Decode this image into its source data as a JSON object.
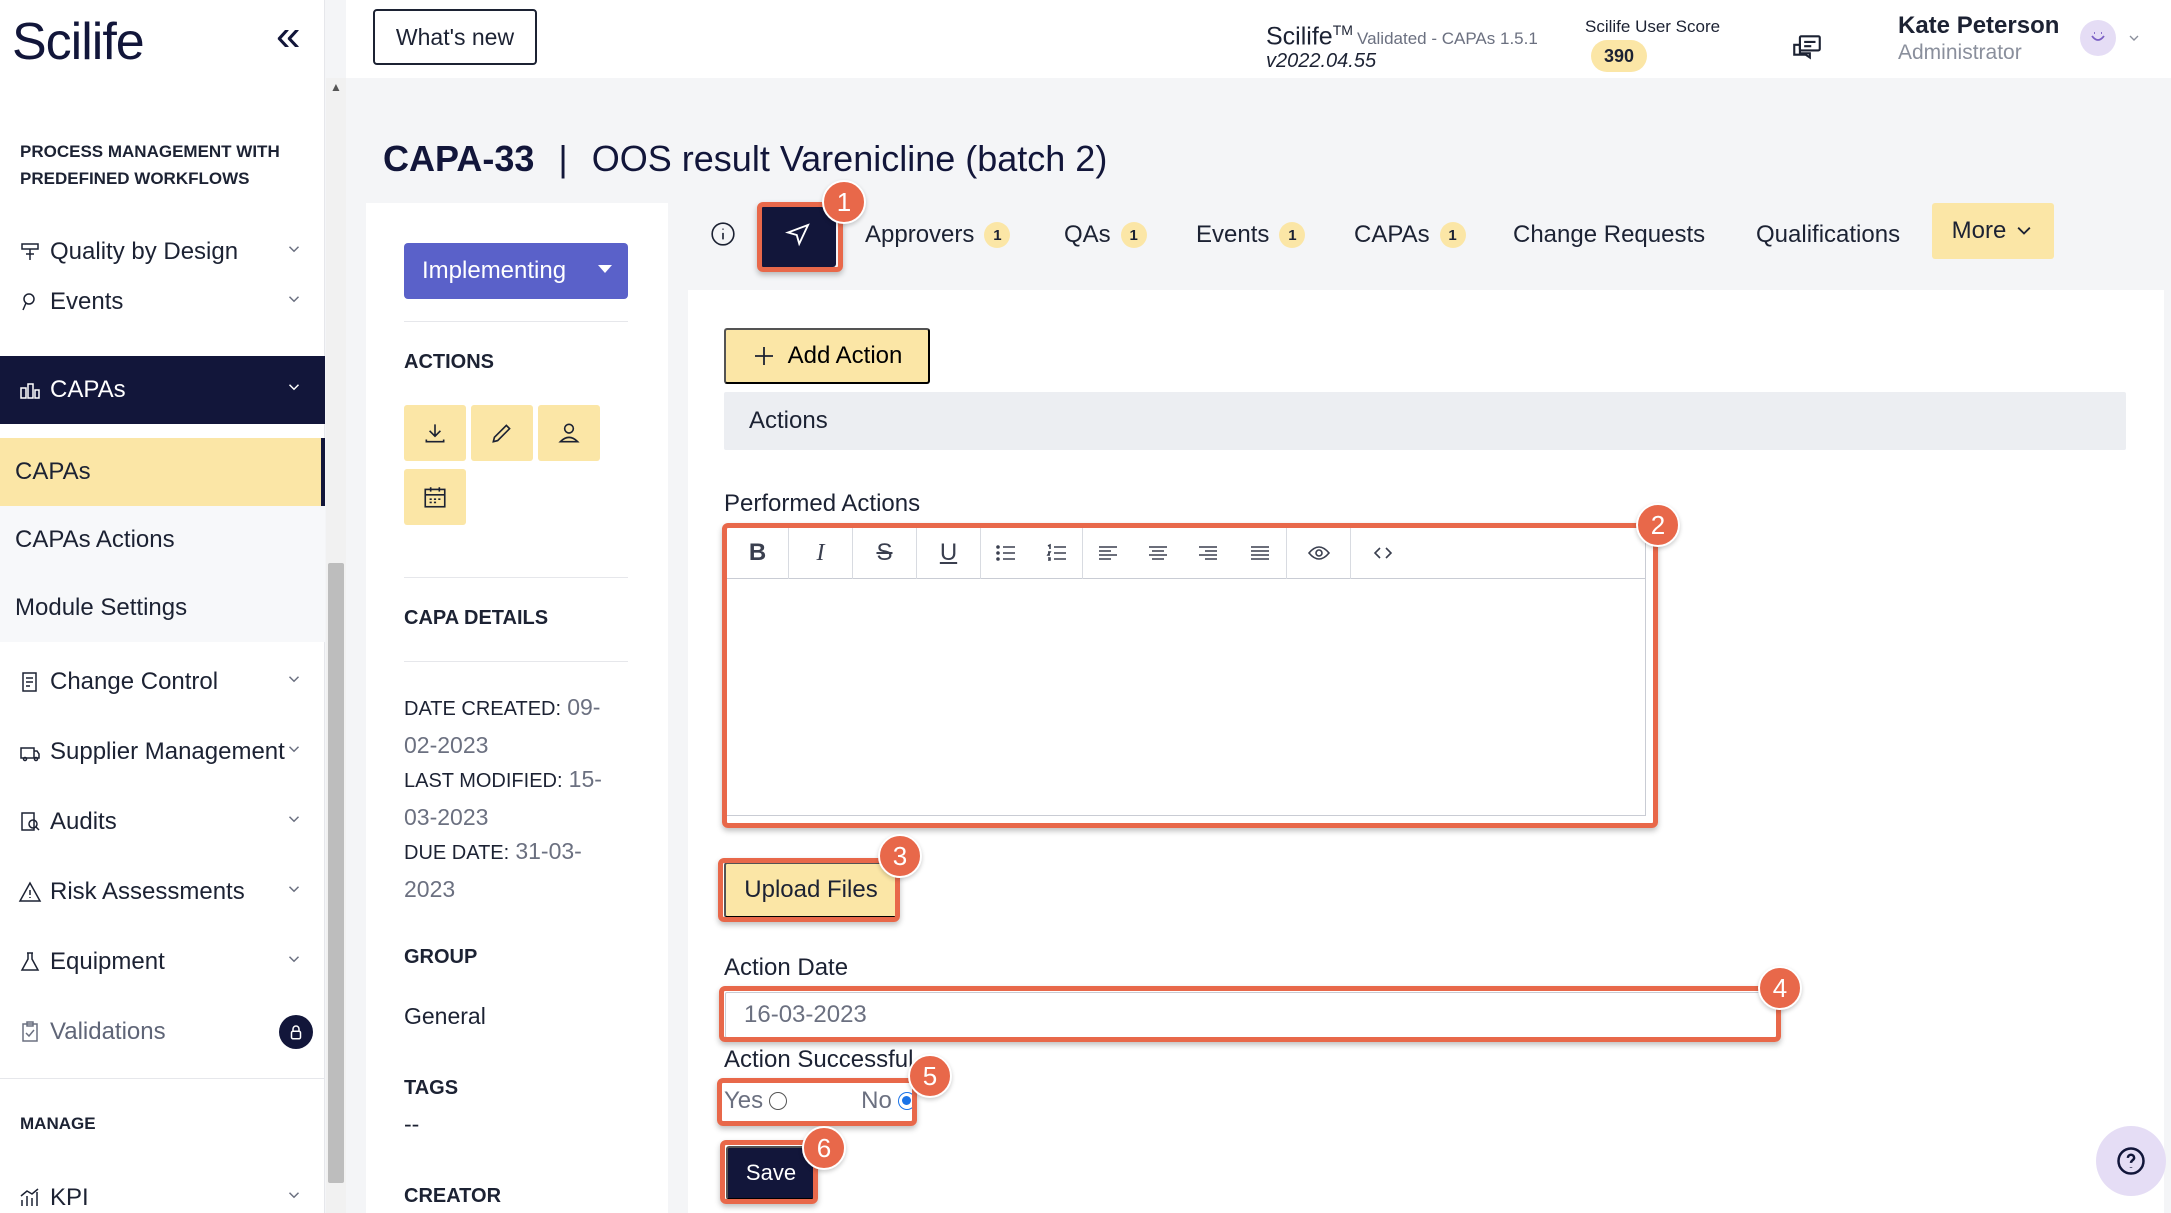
{
  "app": {
    "logo": "Scilife",
    "whats_new": "What's new",
    "version_name": "Scilife",
    "version_tm": "TM",
    "version_status": "Validated - CAPAs 1.5.1",
    "version_number": "v2022.04.55",
    "score_label": "Scilife User Score",
    "score_value": "390",
    "user_name": "Kate Peterson",
    "user_role": "Administrator"
  },
  "sidebar": {
    "section_process": "PROCESS MANAGEMENT WITH PREDEFINED WORKFLOWS",
    "items": [
      {
        "label": "Quality by Design",
        "icon": "quality-design-icon"
      },
      {
        "label": "Events",
        "icon": "event-icon"
      },
      {
        "label": "CAPAs",
        "icon": "capa-icon"
      }
    ],
    "sub_items": [
      {
        "label": "CAPAs"
      },
      {
        "label": "CAPAs Actions"
      },
      {
        "label": "Module Settings"
      }
    ],
    "more_items": [
      {
        "label": "Change Control",
        "icon": "change-control-icon"
      },
      {
        "label": "Supplier Management",
        "icon": "supplier-icon"
      },
      {
        "label": "Audits",
        "icon": "audit-icon"
      },
      {
        "label": "Risk Assessments",
        "icon": "warning-icon"
      },
      {
        "label": "Equipment",
        "icon": "flask-icon"
      },
      {
        "label": "Validations",
        "icon": "clipboard-icon"
      }
    ],
    "section_manage": "MANAGE",
    "kpi": {
      "label": "KPI",
      "icon": "chart-icon"
    }
  },
  "page": {
    "id": "CAPA-33",
    "separator": "|",
    "title": "OOS result Varenicline (batch 2)"
  },
  "left_panel": {
    "status": "Implementing",
    "actions_heading": "ACTIONS",
    "details_heading": "CAPA DETAILS",
    "date_created_label": "DATE CREATED:",
    "date_created": "09-02-2023",
    "last_modified_label": "LAST MODIFIED:",
    "last_modified": "15-03-2023",
    "due_date_label": "DUE DATE:",
    "due_date": "31-03-2023",
    "group_heading": "GROUP",
    "group_value": "General",
    "tags_heading": "TAGS",
    "tags_value": "--",
    "creator_heading": "CREATOR"
  },
  "tabs": [
    {
      "label": "Approvers",
      "count": "1"
    },
    {
      "label": "QAs",
      "count": "1"
    },
    {
      "label": "Events",
      "count": "1"
    },
    {
      "label": "CAPAs",
      "count": "1"
    },
    {
      "label": "Change Requests"
    },
    {
      "label": "Qualifications"
    }
  ],
  "more_label": "More",
  "form": {
    "add_action": "Add Action",
    "actions_band": "Actions",
    "performed_actions_label": "Performed Actions",
    "upload_files": "Upload Files",
    "action_date_label": "Action Date",
    "action_date_value": "16-03-2023",
    "action_successful_label": "Action Successful",
    "yes_label": "Yes",
    "no_label": "No",
    "selected": "No",
    "save": "Save"
  },
  "annotations": [
    "1",
    "2",
    "3",
    "4",
    "5",
    "6"
  ],
  "colors": {
    "navy": "#12163a",
    "accent_yellow": "#fbe6a6",
    "status_purple": "#5a61c9",
    "annotation": "#e8684a"
  }
}
